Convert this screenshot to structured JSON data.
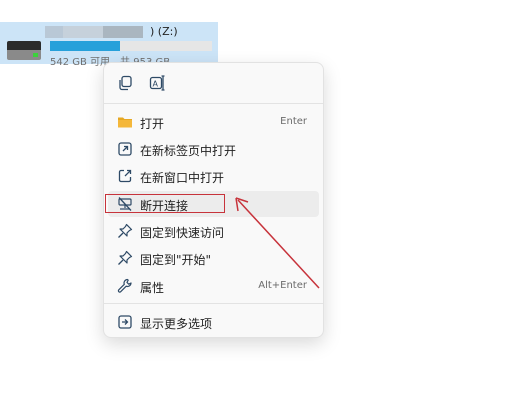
{
  "drive": {
    "name_suffix": ") (Z:)",
    "free_text": "542 GB 可用，共 953 GB",
    "used_fraction": 0.43
  },
  "menu": {
    "quick_actions": [
      {
        "icon": "copy-icon"
      },
      {
        "icon": "rename-icon"
      }
    ],
    "items": [
      {
        "label": "打开",
        "shortcut": "Enter",
        "icon": "folder-icon"
      },
      {
        "label": "在新标签页中打开",
        "icon": "open-new-tab-icon"
      },
      {
        "label": "在新窗口中打开",
        "icon": "open-new-window-icon"
      },
      {
        "label": "断开连接",
        "icon": "disconnect-drive-icon"
      },
      {
        "label": "固定到快速访问",
        "icon": "pin-icon"
      },
      {
        "label": "固定到\"开始\"",
        "icon": "pin-icon"
      },
      {
        "label": "属性",
        "shortcut": "Alt+Enter",
        "icon": "wrench-icon"
      }
    ],
    "more": {
      "label": "显示更多选项",
      "icon": "show-more-icon"
    }
  },
  "annotation": {
    "color": "#c7333b"
  },
  "colors": {
    "accent": "#26a0da",
    "folder": "#f4b73a",
    "menu_icon": "#2e4a66"
  }
}
